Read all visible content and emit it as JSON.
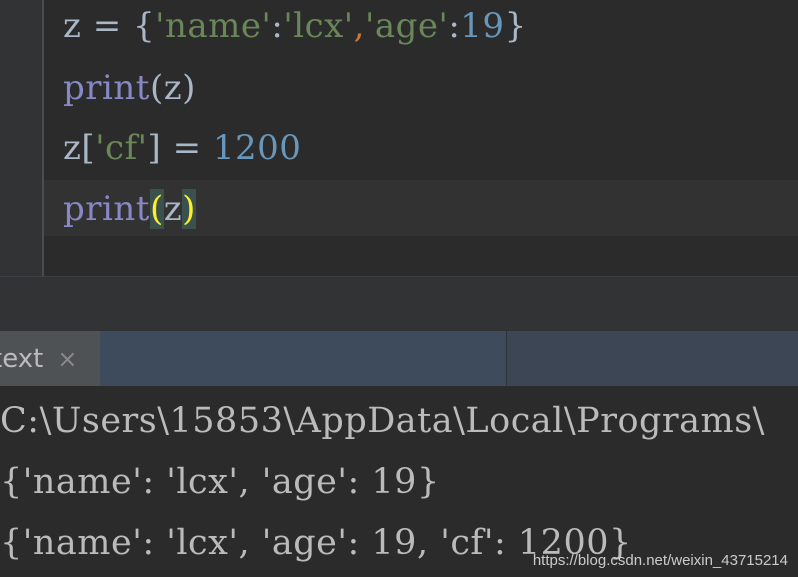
{
  "editor": {
    "lines": [
      {
        "tokens": [
          {
            "t": "z = {",
            "c": "id"
          },
          {
            "t": "'name'",
            "c": "str"
          },
          {
            "t": ":",
            "c": "id"
          },
          {
            "t": "'lcx'",
            "c": "str"
          },
          {
            "t": ",",
            "c": "comma"
          },
          {
            "t": "'age'",
            "c": "str"
          },
          {
            "t": ":",
            "c": "id"
          },
          {
            "t": "19",
            "c": "num"
          },
          {
            "t": "}",
            "c": "id"
          }
        ]
      },
      {
        "tokens": [
          {
            "t": "print",
            "c": "kw"
          },
          {
            "t": "(z)",
            "c": "id"
          }
        ]
      },
      {
        "tokens": [
          {
            "t": "z[",
            "c": "id"
          },
          {
            "t": "'cf'",
            "c": "str"
          },
          {
            "t": "] = ",
            "c": "id"
          },
          {
            "t": "1200",
            "c": "num"
          }
        ]
      },
      {
        "tokens": [
          {
            "t": "print",
            "c": "kw"
          },
          {
            "t": "(",
            "c": "brace-hl"
          },
          {
            "t": "z",
            "c": "id"
          },
          {
            "t": ")",
            "c": "brace-hl"
          }
        ]
      }
    ]
  },
  "run": {
    "tab_label": "text",
    "close_glyph": "×"
  },
  "console": {
    "lines": [
      "C:\\Users\\15853\\AppData\\Local\\Programs\\",
      "{'name': 'lcx', 'age': 19}",
      "{'name': 'lcx', 'age': 19, 'cf': 1200}"
    ]
  },
  "watermark": "https://blog.csdn.net/weixin_43715214",
  "colors": {
    "background": "#2b2b2b",
    "string": "#6a8759",
    "number": "#6897bb",
    "keyword": "#8888c6",
    "identifier": "#a9b7c6",
    "brace_highlight": "#ffef28"
  }
}
